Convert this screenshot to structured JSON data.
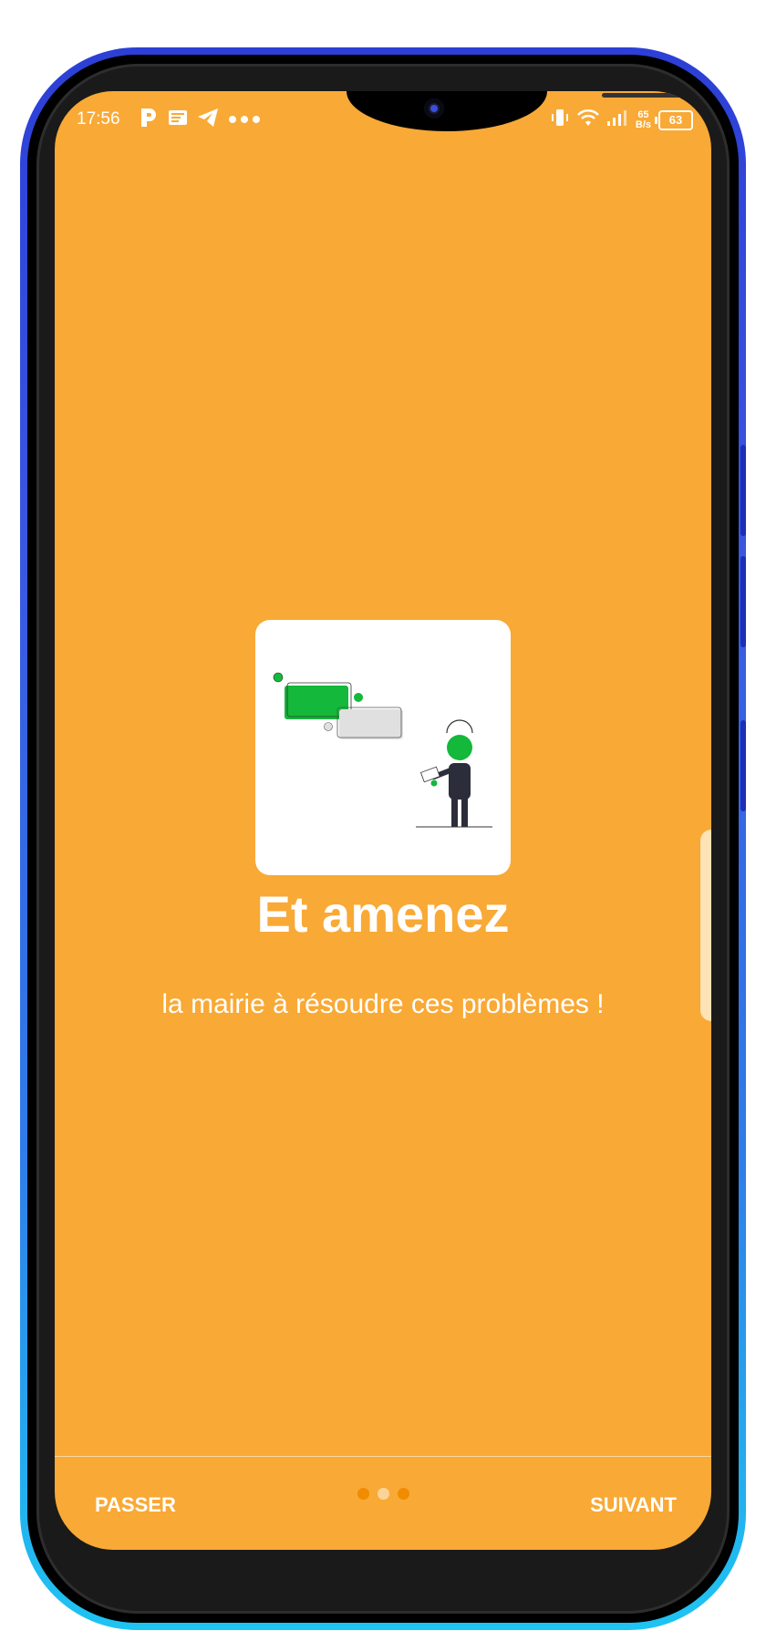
{
  "status_bar": {
    "time": "17:56",
    "left_icons": [
      "p-app-icon",
      "news-icon",
      "telegram-icon",
      "more-dots-icon"
    ],
    "right_icons": [
      "vibrate-icon",
      "wifi-icon",
      "signal-icon"
    ],
    "net_speed_value": "65",
    "net_speed_unit": "B/s",
    "battery": "63"
  },
  "onboarding": {
    "title": "Et amenez",
    "subtitle": "la mairie à résoudre ces problèmes !",
    "illustration_icon": "person-with-chat-bubbles-illustration",
    "page_count": 3,
    "current_page": 2
  },
  "footer": {
    "skip_label": "PASSER",
    "next_label": "SUIVANT"
  },
  "colors": {
    "background": "#f9a935",
    "dot_active": "#fcd49a",
    "dot_inactive": "#f08c00",
    "illustration_green": "#14b83a",
    "frame_blue_top": "#2c3fd6",
    "frame_blue_bottom": "#1ec4f2"
  }
}
